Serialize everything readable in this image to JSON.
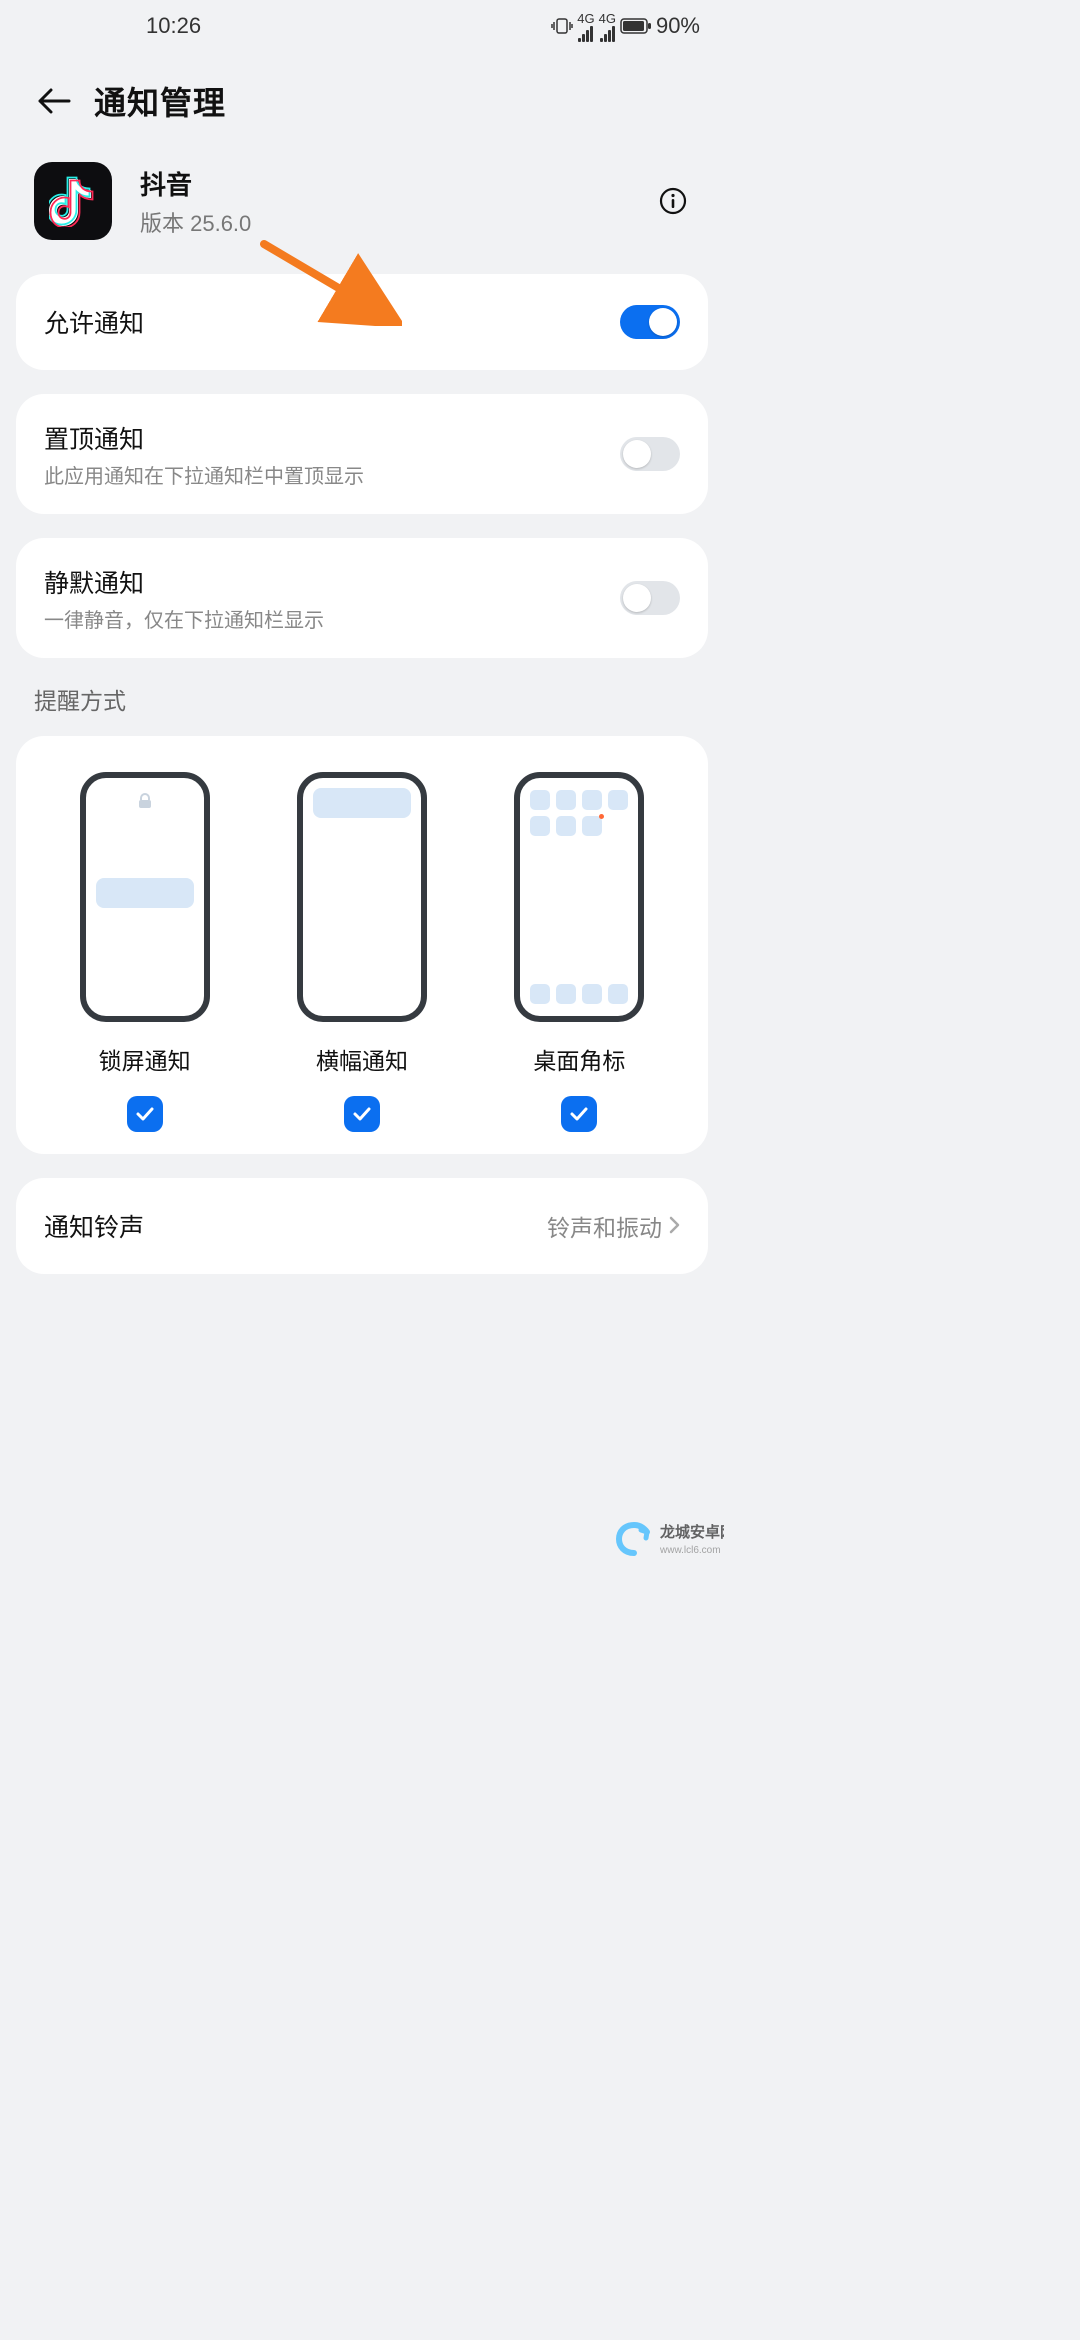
{
  "statusbar": {
    "time": "10:26",
    "battery": "90%",
    "net_label_1": "4G",
    "net_label_2": "4G"
  },
  "header": {
    "title": "通知管理"
  },
  "app": {
    "name": "抖音",
    "version": "版本 25.6.0"
  },
  "rows": {
    "allow": {
      "label": "允许通知",
      "on": true
    },
    "pinned": {
      "label": "置顶通知",
      "sub": "此应用通知在下拉通知栏中置顶显示",
      "on": false
    },
    "silent": {
      "label": "静默通知",
      "sub": "一律静音，仅在下拉通知栏显示",
      "on": false
    }
  },
  "section": {
    "reminder_label": "提醒方式"
  },
  "modes": {
    "lock": {
      "label": "锁屏通知",
      "checked": true
    },
    "banner": {
      "label": "横幅通知",
      "checked": true
    },
    "badge": {
      "label": "桌面角标",
      "checked": true
    }
  },
  "sound": {
    "label": "通知铃声",
    "value": "铃声和振动"
  },
  "watermark": {
    "text": "龙城安卓网"
  }
}
